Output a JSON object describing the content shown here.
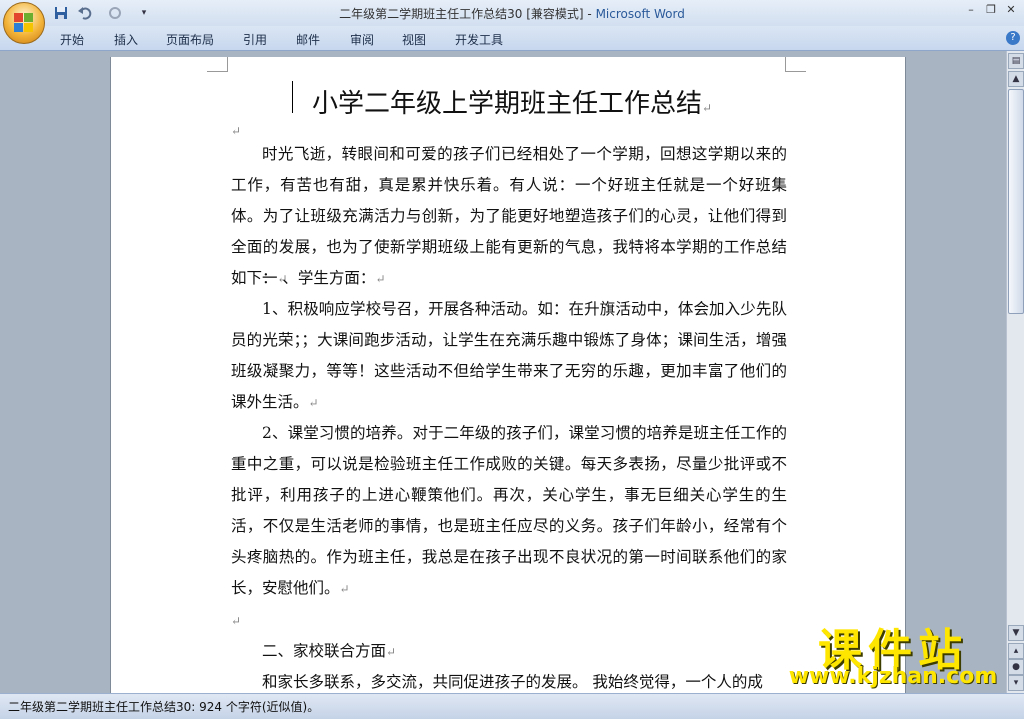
{
  "window": {
    "doc_title": "二年级第二学期班主任工作总结30 [兼容模式]",
    "separator": " - ",
    "app_name": "Microsoft Word",
    "controls": [
      "–",
      "❐",
      "✕"
    ]
  },
  "quick_access": {
    "save_icon": "floppy-disk",
    "undo_icon": "undo-arrow",
    "redo_icon": "redo-arrow",
    "customize_icon": "dropdown-arrow"
  },
  "ribbon_tabs": [
    "开始",
    "插入",
    "页面布局",
    "引用",
    "邮件",
    "审阅",
    "视图",
    "开发工具"
  ],
  "document": {
    "title": "小学二年级上学期班主任工作总结",
    "paragraphs": [
      "",
      "时光飞逝，转眼间和可爱的孩子们已经相处了一个学期，回想这学期以来的工作，有苦也有甜，真是累并快乐着。有人说：一个好班主任就是一个好班集体。为了让班级充满活力与创新，为了能更好地塑造孩子们的心灵，让他们得到全面的发展，也为了使新学期班级上能有更新的气息，我特将本学期的工作总结如下：",
      "一 、学生方面：",
      "1、积极响应学校号召，开展各种活动。如：在升旗活动中，体会加入少先队员的光荣；；大课间跑步活动，让学生在充满乐趣中锻炼了身体；课间生活，增强班级凝聚力，等等！这些活动不但给学生带来了无穷的乐趣，更加丰富了他们的课外生活。",
      "2、课堂习惯的培养。对于二年级的孩子们，课堂习惯的培养是班主任工作的重中之重，可以说是检验班主任工作成败的关键。每天多表扬，尽量少批评或不批评，利用孩子的上进心鞭策他们。再次，关心学生，事无巨细关心学生的生活，不仅是生活老师的事情，也是班主任应尽的义务。孩子们年龄小，经常有个头疼脑热的。作为班主任，我总是在孩子出现不良状况的第一时间联系他们的家长，安慰他们。",
      "",
      "二、家校联合方面",
      "和家长多联系，多交流，共同促进孩子的发展。 我始终觉得，一个人的成"
    ],
    "paragraph_mark": "↵"
  },
  "status": {
    "text": "二年级第二学期班主任工作总结30: 924 个字符(近似值)。"
  },
  "watermark": {
    "brand": "课件站",
    "url": "www.kjzhan.com"
  }
}
